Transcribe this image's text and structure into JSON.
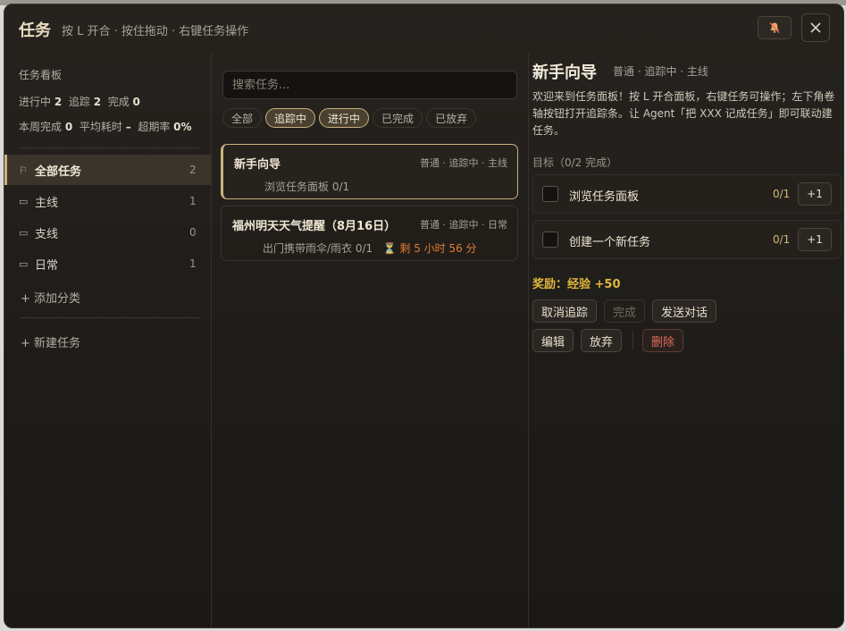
{
  "header": {
    "title": "任务",
    "hint": "按 L 开合 · 按住拖动 · 右键任务操作",
    "mute_icon": "bell-muted-icon",
    "close_icon": "close-icon"
  },
  "sidebar": {
    "board_title": "任务看板",
    "stats": {
      "in_progress_label": "进行中",
      "in_progress": "2",
      "tracking_label": "追踪",
      "tracking": "2",
      "done_label": "完成",
      "done": "0",
      "week_done_label": "本周完成",
      "week_done": "0",
      "avg_time_label": "平均耗时",
      "avg_time": "–",
      "overdue_label": "超期率",
      "overdue": "0%"
    },
    "items": [
      {
        "label": "全部任务",
        "count": "2",
        "icon": "flag-icon"
      },
      {
        "label": "主线",
        "count": "1",
        "icon": "folder-icon"
      },
      {
        "label": "支线",
        "count": "0",
        "icon": "folder-icon"
      },
      {
        "label": "日常",
        "count": "1",
        "icon": "folder-icon"
      }
    ],
    "add_category": "+ 添加分类",
    "new_task": "+ 新建任务"
  },
  "list": {
    "search_placeholder": "搜索任务...",
    "filters": [
      {
        "label": "全部",
        "active": false
      },
      {
        "label": "追踪中",
        "active": true
      },
      {
        "label": "进行中",
        "active": true
      },
      {
        "label": "已完成",
        "active": false
      },
      {
        "label": "已放弃",
        "active": false
      }
    ],
    "tasks": [
      {
        "title": "新手向导",
        "meta": "普通 · 追踪中 · 主线",
        "sub": "浏览任务面板 0/1",
        "timer": ""
      },
      {
        "title": "福州明天天气提醒（8月16日）",
        "meta": "普通 · 追踪中 · 日常",
        "sub": "出门携带雨伞/雨衣 0/1",
        "timer": "⏳ 剩 5 小时 56 分"
      }
    ]
  },
  "detail": {
    "title": "新手向导",
    "meta": "普通 · 追踪中 · 主线",
    "description": "欢迎来到任务面板！按 L 开合面板，右键任务可操作；左下角卷轴按钮打开追踪条。让 Agent「把 XXX 记成任务」即可联动建任务。",
    "goals_header": "目标（0/2 完成）",
    "goals": [
      {
        "label": "浏览任务面板",
        "progress": "0/1",
        "plus": "+1"
      },
      {
        "label": "创建一个新任务",
        "progress": "0/1",
        "plus": "+1"
      }
    ],
    "reward": "奖励：经验 +50",
    "actions": {
      "untrack": "取消追踪",
      "complete": "完成",
      "send_chat": "发送对话",
      "edit": "编辑",
      "abandon": "放弃",
      "delete": "删除"
    }
  },
  "colors": {
    "accent": "#c9b27f",
    "timer": "#e07a2e",
    "reward": "#e0b73d",
    "danger": "#e06a5a"
  }
}
